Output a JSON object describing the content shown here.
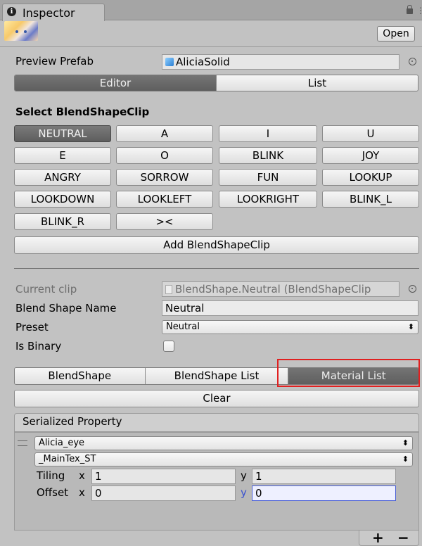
{
  "window": {
    "tab_title": "Inspector",
    "open_label": "Open"
  },
  "preview": {
    "label": "Preview Prefab",
    "value": "AliciaSolid"
  },
  "mode_tabs": [
    "Editor",
    "List"
  ],
  "clips": {
    "heading": "Select BlendShapeClip",
    "buttons": [
      "NEUTRAL",
      "A",
      "I",
      "U",
      "E",
      "O",
      "BLINK",
      "JOY",
      "ANGRY",
      "SORROW",
      "FUN",
      "LOOKUP",
      "LOOKDOWN",
      "LOOKLEFT",
      "LOOKRIGHT",
      "BLINK_L",
      "BLINK_R",
      "><"
    ],
    "selected": "NEUTRAL",
    "add_label": "Add BlendShapeClip"
  },
  "clip_props": {
    "current_clip_label": "Current clip",
    "current_clip_value": "BlendShape.Neutral (BlendShapeClip",
    "name_label": "Blend Shape Name",
    "name_value": "Neutral",
    "preset_label": "Preset",
    "preset_value": "Neutral",
    "binary_label": "Is Binary"
  },
  "sub_tabs": [
    "BlendShape",
    "BlendShape List",
    "Material List"
  ],
  "clear_label": "Clear",
  "serialized": {
    "header": "Serialized Property",
    "material": "Alicia_eye",
    "property": "_MainTex_ST",
    "tiling_label": "Tiling",
    "offset_label": "Offset",
    "x_label": "x",
    "y_label": "y",
    "tiling_x": "1",
    "tiling_y": "1",
    "offset_x": "0",
    "offset_y": "0"
  },
  "footer": {
    "plus": "+",
    "minus": "−"
  },
  "colors": {
    "selected_tab": "#5f5f5f",
    "highlight": "#e02020",
    "focus": "#4a5fd6"
  }
}
